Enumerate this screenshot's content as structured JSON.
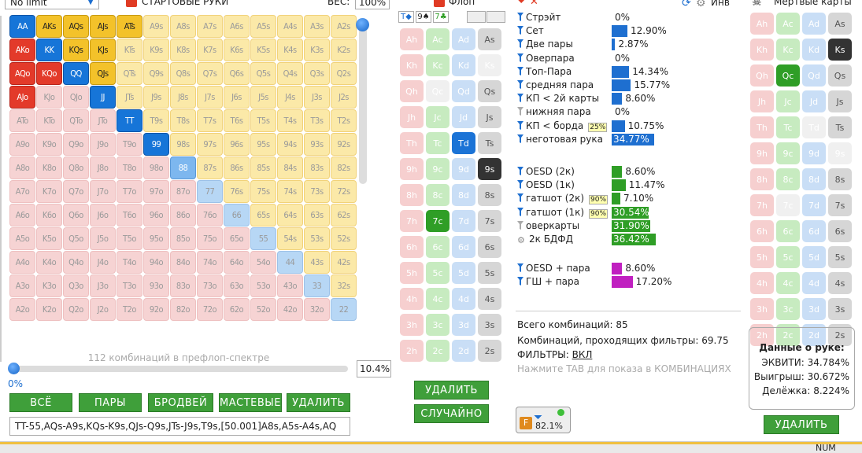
{
  "top": {
    "limit": "No limit",
    "start_hands": "СТАРТОВЫЕ РУКИ",
    "weight_label": "ВЕС:",
    "weight": "100%",
    "flop": "Флоп",
    "inv": "Инв",
    "dead_cards": "Мертвые карты"
  },
  "grid": [
    [
      "AA",
      "AKs",
      "AQs",
      "AJs",
      "ATs",
      "A9s",
      "A8s",
      "A7s",
      "A6s",
      "A5s",
      "A4s",
      "A3s",
      "A2s"
    ],
    [
      "AKo",
      "KK",
      "KQs",
      "KJs",
      "KTs",
      "K9s",
      "K8s",
      "K7s",
      "K6s",
      "K5s",
      "K4s",
      "K3s",
      "K2s"
    ],
    [
      "AQo",
      "KQo",
      "QQ",
      "QJs",
      "QTs",
      "Q9s",
      "Q8s",
      "Q7s",
      "Q6s",
      "Q5s",
      "Q4s",
      "Q3s",
      "Q2s"
    ],
    [
      "AJo",
      "KJo",
      "QJo",
      "JJ",
      "JTs",
      "J9s",
      "J8s",
      "J7s",
      "J6s",
      "J5s",
      "J4s",
      "J3s",
      "J2s"
    ],
    [
      "ATo",
      "KTo",
      "QTo",
      "JTo",
      "TT",
      "T9s",
      "T8s",
      "T7s",
      "T6s",
      "T5s",
      "T4s",
      "T3s",
      "T2s"
    ],
    [
      "A9o",
      "K9o",
      "Q9o",
      "J9o",
      "T9o",
      "99",
      "98s",
      "97s",
      "96s",
      "95s",
      "94s",
      "93s",
      "92s"
    ],
    [
      "A8o",
      "K8o",
      "Q8o",
      "J8o",
      "T8o",
      "98o",
      "88",
      "87s",
      "86s",
      "85s",
      "84s",
      "83s",
      "82s"
    ],
    [
      "A7o",
      "K7o",
      "Q7o",
      "J7o",
      "T7o",
      "97o",
      "87o",
      "77",
      "76s",
      "75s",
      "74s",
      "73s",
      "72s"
    ],
    [
      "A6o",
      "K6o",
      "Q6o",
      "J6o",
      "T6o",
      "96o",
      "86o",
      "76o",
      "66",
      "65s",
      "64s",
      "63s",
      "62s"
    ],
    [
      "A5o",
      "K5o",
      "Q5o",
      "J5o",
      "T5o",
      "95o",
      "85o",
      "75o",
      "65o",
      "55",
      "54s",
      "53s",
      "52s"
    ],
    [
      "A4o",
      "K4o",
      "Q4o",
      "J4o",
      "T4o",
      "94o",
      "84o",
      "74o",
      "64o",
      "54o",
      "44",
      "43s",
      "42s"
    ],
    [
      "A3o",
      "K3o",
      "Q3o",
      "J3o",
      "T3o",
      "93o",
      "83o",
      "73o",
      "63o",
      "53o",
      "43o",
      "33",
      "32s"
    ],
    [
      "A2o",
      "K2o",
      "Q2o",
      "J2o",
      "T2o",
      "92o",
      "82o",
      "72o",
      "62o",
      "52o",
      "42o",
      "32o",
      "22"
    ]
  ],
  "range": {
    "combo_text": "112 комбинаций в префлоп-спектре",
    "pct": "10.4%",
    "slider_label": "0%",
    "hand_text": "TT-55,AQs-A9s,KQs-K9s,QJs-Q9s,JTs-J9s,T9s,[50.001]A8s,A5s-A4s,AQ"
  },
  "buttons": {
    "all": "ВСЁ",
    "pairs": "ПАРЫ",
    "broadway": "БРОДВЕЙ",
    "suited": "МАСТЕВЫЕ",
    "delete": "УДАЛИТЬ",
    "delete2": "УДАЛИТЬ",
    "random": "СЛУЧАЙНО",
    "delete3": "УДАЛИТЬ"
  },
  "board": [
    "T◆",
    "9♠",
    "7♣",
    "",
    ""
  ],
  "flop_cards": [
    [
      "Ah",
      "Ac",
      "Ad",
      "As"
    ],
    [
      "Kh",
      "Kc",
      "Kd",
      "Ks"
    ],
    [
      "Qh",
      "Qc",
      "Qd",
      "Qs"
    ],
    [
      "Jh",
      "Jc",
      "Jd",
      "Js"
    ],
    [
      "Th",
      "Tc",
      "Td",
      "Ts"
    ],
    [
      "9h",
      "9c",
      "9d",
      "9s"
    ],
    [
      "8h",
      "8c",
      "8d",
      "8s"
    ],
    [
      "7h",
      "7c",
      "7d",
      "7s"
    ],
    [
      "6h",
      "6c",
      "6d",
      "6s"
    ],
    [
      "5h",
      "5c",
      "5d",
      "5s"
    ],
    [
      "4h",
      "4c",
      "4d",
      "4s"
    ],
    [
      "3h",
      "3c",
      "3d",
      "3s"
    ],
    [
      "2h",
      "2c",
      "2d",
      "2s"
    ]
  ],
  "dead": [
    [
      "Ah",
      "Ac",
      "Ad",
      "As"
    ],
    [
      "Kh",
      "Kc",
      "Kd",
      "Ks"
    ],
    [
      "Qh",
      "Qc",
      "Qd",
      "Qs"
    ],
    [
      "Jh",
      "Jc",
      "Jd",
      "Js"
    ],
    [
      "Th",
      "Tc",
      "Td",
      "Ts"
    ],
    [
      "9h",
      "9c",
      "9d",
      "9s"
    ],
    [
      "8h",
      "8c",
      "8d",
      "8s"
    ],
    [
      "7h",
      "7c",
      "7d",
      "7s"
    ],
    [
      "6h",
      "6c",
      "6d",
      "6s"
    ],
    [
      "5h",
      "5c",
      "5d",
      "5s"
    ],
    [
      "4h",
      "4c",
      "4d",
      "4s"
    ],
    [
      "3h",
      "3c",
      "3d",
      "3s"
    ],
    [
      "2h",
      "2c",
      "2d",
      "2s"
    ]
  ],
  "stats": [
    {
      "label": "Стрэйт",
      "value": "0%",
      "pct": 0,
      "color": "#1e6fd0"
    },
    {
      "label": "Сет",
      "value": "12.90%",
      "pct": 12.9,
      "color": "#1e6fd0"
    },
    {
      "label": "Две пары",
      "value": "2.87%",
      "pct": 2.87,
      "color": "#1e6fd0"
    },
    {
      "label": "Оверпара",
      "value": "0%",
      "pct": 0,
      "color": "#1e6fd0"
    },
    {
      "label": "Топ-Пара",
      "value": "14.34%",
      "pct": 14.34,
      "color": "#1e6fd0"
    },
    {
      "label": "средняя пара",
      "value": "15.77%",
      "pct": 15.77,
      "color": "#1e6fd0"
    },
    {
      "label": "КП < 2й карты",
      "value": "8.60%",
      "pct": 8.6,
      "color": "#1e6fd0"
    },
    {
      "label": "нижняя пара",
      "value": "0%",
      "pct": 0,
      "color": "#1e6fd0"
    },
    {
      "label": "КП < борда",
      "value": "10.75%",
      "pct": 10.75,
      "color": "#1e6fd0",
      "tag": "25%"
    },
    {
      "label": "неготовая рука",
      "value": "34.77%",
      "pct": 34.77,
      "color": "#1e6fd0"
    }
  ],
  "draws": [
    {
      "label": "OESD (2к)",
      "value": "8.60%",
      "pct": 8.6,
      "color": "#2f9e26"
    },
    {
      "label": "OESD (1к)",
      "value": "11.47%",
      "pct": 11.47,
      "color": "#2f9e26"
    },
    {
      "label": "гатшот (2к)",
      "value": "7.10%",
      "pct": 7.1,
      "color": "#2f9e26",
      "tag": "90%"
    },
    {
      "label": "гатшот (1к)",
      "value": "30.54%",
      "pct": 30.54,
      "color": "#2f9e26",
      "tag": "90%"
    },
    {
      "label": "оверкарты",
      "value": "31.90%",
      "pct": 31.9,
      "color": "#2f9e26"
    },
    {
      "label": "2к БДФД",
      "value": "36.42%",
      "pct": 36.42,
      "color": "#2f9e26"
    }
  ],
  "combos": [
    {
      "label": "OESD + пара",
      "value": "8.60%",
      "pct": 8.6,
      "color": "#c020c0"
    },
    {
      "label": "ГШ + пара",
      "value": "17.20%",
      "pct": 17.2,
      "color": "#c020c0"
    }
  ],
  "info": {
    "total": "Всего комбинаций: 85",
    "passing": "Комбинаций, проходящих фильтры: 69.75",
    "filters_label": "ФИЛЬТРЫ:",
    "filters_val": "ВКЛ",
    "hint": "Нажмите TAB для показа в КОМБИНАЦИЯХ",
    "badge": "82.1%"
  },
  "hand_data": {
    "title": "Данные о руке:",
    "equity": "ЭКВИТИ: 34.784%",
    "win": "Выигрыш: 30.672%",
    "split": "Делёжка: 8.224%"
  },
  "status": {
    "num": "NUM"
  }
}
